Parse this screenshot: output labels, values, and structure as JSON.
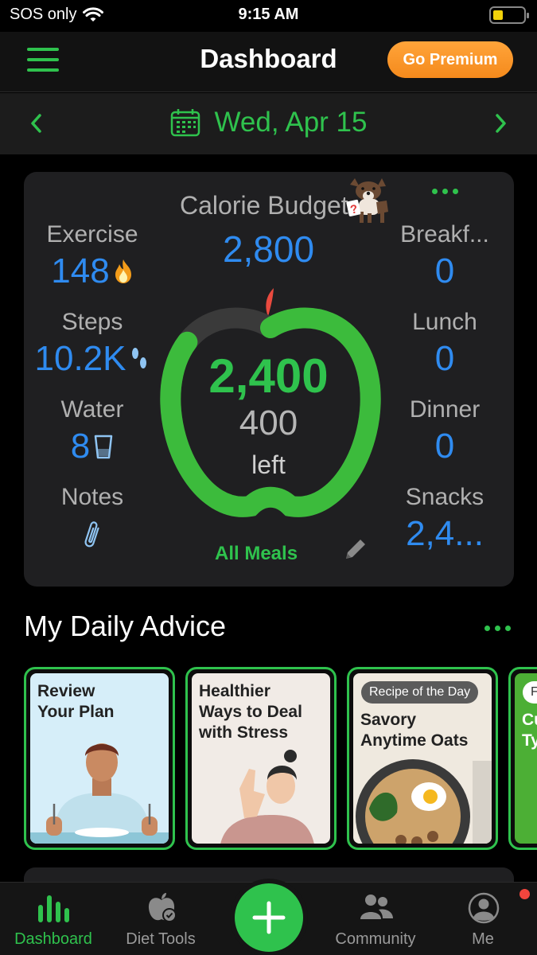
{
  "status_bar": {
    "carrier": "SOS only",
    "time": "9:15 AM"
  },
  "header": {
    "title": "Dashboard",
    "premium_label": "Go Premium"
  },
  "date_nav": {
    "date": "Wed, Apr 15"
  },
  "summary": {
    "exercise": {
      "label": "Exercise",
      "value": "148"
    },
    "steps": {
      "label": "Steps",
      "value": "10.2K"
    },
    "water": {
      "label": "Water",
      "value": "8"
    },
    "notes": {
      "label": "Notes"
    },
    "budget": {
      "label": "Calorie Budget",
      "value": "2,800"
    },
    "eaten": "2,400",
    "left_value": "400",
    "left_label": "left",
    "progress_fraction": 0.857,
    "all_meals_label": "All Meals",
    "breakfast": {
      "label": "Breakf...",
      "value": "0"
    },
    "lunch": {
      "label": "Lunch",
      "value": "0"
    },
    "dinner": {
      "label": "Dinner",
      "value": "0"
    },
    "snacks": {
      "label": "Snacks",
      "value": "2,4..."
    }
  },
  "advice": {
    "title": "My Daily Advice",
    "cards": [
      {
        "text": "Review\nYour Plan"
      },
      {
        "text": "Healthier\nWays to Deal\nwith Stress"
      },
      {
        "badge": "Recipe of the Day",
        "text": "Savory\nAnytime Oats"
      },
      {
        "badge": "Fe",
        "text": "Cu\nTy"
      }
    ]
  },
  "tabs": [
    {
      "label": "Dashboard",
      "icon": "bar-chart-icon",
      "active": true
    },
    {
      "label": "Diet Tools",
      "icon": "apple-check-icon"
    },
    {
      "label": "Community",
      "icon": "people-icon"
    },
    {
      "label": "Me",
      "icon": "person-circle-icon"
    }
  ],
  "colors": {
    "accent": "#2fc24d",
    "value_blue": "#2f8bf0",
    "premium": "#f7941e"
  }
}
